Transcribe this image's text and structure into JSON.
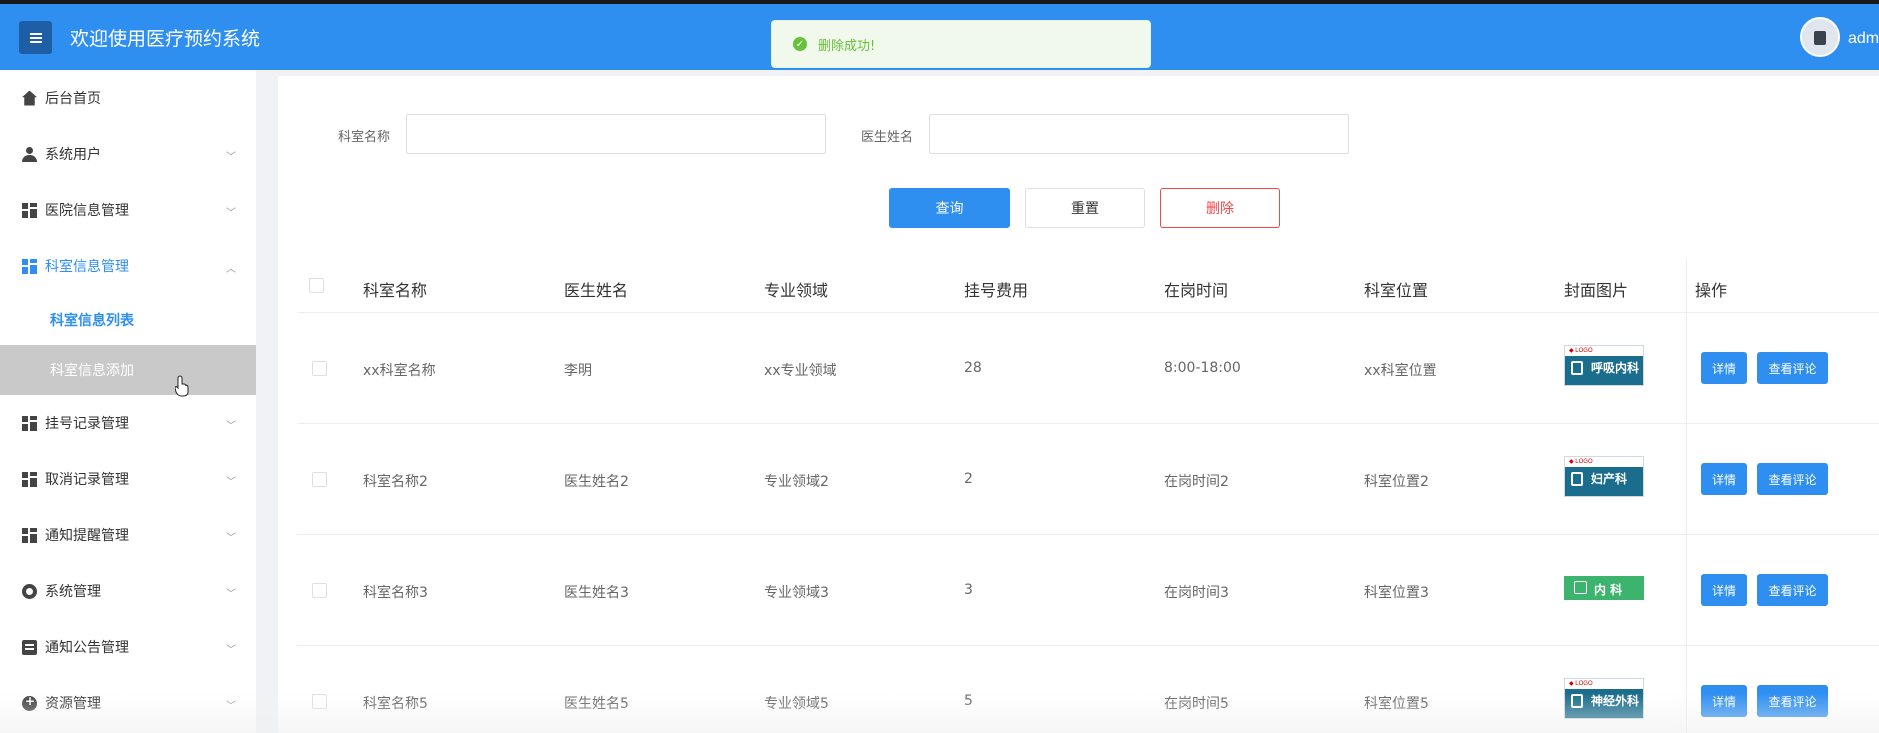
{
  "header": {
    "title": "欢迎使用医疗预约系统",
    "user": "adm",
    "menu_icon": "hamburger-icon",
    "accent_color": "#2f8ff1"
  },
  "toast": {
    "message": "删除成功!",
    "icon": "check-circle-icon",
    "color": "#67c23a"
  },
  "sidebar": {
    "items": [
      {
        "label": "后台首页",
        "icon": "home-icon"
      },
      {
        "label": "系统用户",
        "icon": "user-icon"
      },
      {
        "label": "医院信息管理",
        "icon": "grid-icon"
      },
      {
        "label": "科室信息管理",
        "icon": "grid-icon"
      },
      {
        "label": "挂号记录管理",
        "icon": "grid-icon"
      },
      {
        "label": "取消记录管理",
        "icon": "grid-icon"
      },
      {
        "label": "通知提醒管理",
        "icon": "grid-icon"
      },
      {
        "label": "系统管理",
        "icon": "gear-icon"
      },
      {
        "label": "通知公告管理",
        "icon": "document-icon"
      },
      {
        "label": "资源管理",
        "icon": "resource-icon"
      }
    ],
    "sub_items": [
      {
        "label": "科室信息列表"
      },
      {
        "label": "科室信息添加"
      }
    ]
  },
  "search": {
    "dept_label": "科室名称",
    "dept_value": "",
    "doctor_label": "医生姓名",
    "doctor_value": "",
    "query_label": "查询",
    "reset_label": "重置",
    "delete_label": "删除"
  },
  "table": {
    "headers": [
      "科室名称",
      "医生姓名",
      "专业领域",
      "挂号费用",
      "在岗时间",
      "科室位置",
      "封面图片",
      "操作"
    ],
    "detail_label": "详情",
    "review_label": "查看评论",
    "rows": [
      {
        "dept": "xx科室名称",
        "doctor": "李明",
        "field": "xx专业领域",
        "fee": "28",
        "time": "8:00-18:00",
        "location": "xx科室位置",
        "cover": "呼吸内科"
      },
      {
        "dept": "科室名称2",
        "doctor": "医生姓名2",
        "field": "专业领域2",
        "fee": "2",
        "time": "在岗时间2",
        "location": "科室位置2",
        "cover": "妇产科"
      },
      {
        "dept": "科室名称3",
        "doctor": "医生姓名3",
        "field": "专业领域3",
        "fee": "3",
        "time": "在岗时间3",
        "location": "科室位置3",
        "cover": "内 科"
      },
      {
        "dept": "科室名称5",
        "doctor": "医生姓名5",
        "field": "专业领域5",
        "fee": "5",
        "time": "在岗时间5",
        "location": "科室位置5",
        "cover": "神经外科"
      }
    ]
  }
}
